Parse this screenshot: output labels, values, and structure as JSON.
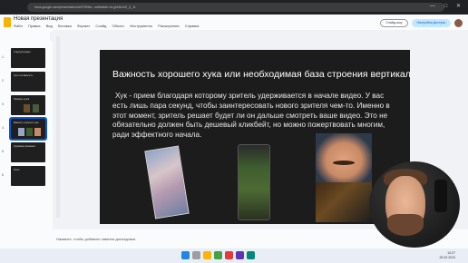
{
  "browser": {
    "url": "docs.google.com/presentation/d/1FW9kc...edit#slide=id.g2e8c1d2_0_11"
  },
  "app": {
    "title": "Новая презентация",
    "menu": [
      "Файл",
      "Правка",
      "Вид",
      "Вставка",
      "Формат",
      "Слайд",
      "Объект",
      "Инструменты",
      "Расширения",
      "Справка"
    ],
    "slideshow_label": "Слайд-шоу",
    "share_label": "Настройки Доступа"
  },
  "toolbar": {
    "items": [
      "Меню",
      "Фон",
      "Макет",
      "Тема",
      "Переход"
    ],
    "image_items": [
      "Заменить изображение",
      "Параметры форматирования",
      "Анимировать"
    ]
  },
  "sidebar": {
    "slide_numbers": [
      "1",
      "2",
      "3",
      "4",
      "5",
      "6"
    ],
    "thumb_titles": [
      "Структура видео",
      "Хук и его важность",
      "Примеры хуков",
      "Важность хорошего хука",
      "Удержание внимания",
      "Итоги"
    ]
  },
  "slide": {
    "title": "Важность хорошего хука или необходимая база строения вертикалки",
    "body": "Хук - прием благодаря которому зритель удерживается в начале видео. У вас есть лишь пара секунд, чтобы заинтересовать нового зрителя чем-то. Именно в этот момент, зритель решает будет ли он дальше смотреть ваше видео. Это не обязательно должен быть дешевый кликбейт, но можно пожертвовать многим, ради эффектного начала."
  },
  "notes": {
    "placeholder": "Нажмите, чтобы добавить заметки докладчика"
  },
  "taskbar": {
    "time": "13:27",
    "date": "26.02.2024"
  },
  "colors": {
    "slide_bg": "#1c1c1c",
    "accent": "#0b57d0",
    "share_bg": "#c2e7ff"
  }
}
